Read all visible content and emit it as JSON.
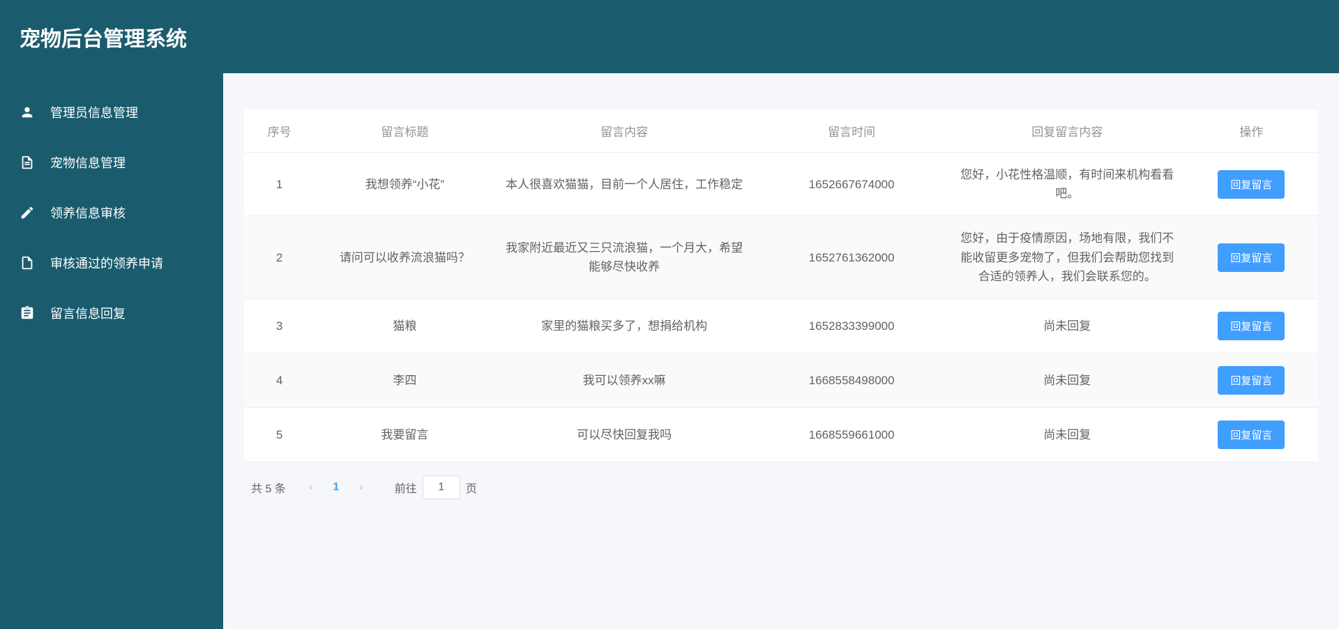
{
  "header": {
    "title": "宠物后台管理系统"
  },
  "sidebar": {
    "items": [
      {
        "label": "管理员信息管理",
        "icon": "user-icon"
      },
      {
        "label": "宠物信息管理",
        "icon": "document-icon"
      },
      {
        "label": "领养信息审核",
        "icon": "edit-icon"
      },
      {
        "label": "审核通过的领养申请",
        "icon": "file-icon"
      },
      {
        "label": "留言信息回复",
        "icon": "clipboard-icon"
      }
    ]
  },
  "table": {
    "headers": {
      "seq": "序号",
      "title": "留言标题",
      "content": "留言内容",
      "time": "留言时间",
      "reply": "回复留言内容",
      "action": "操作"
    },
    "rows": [
      {
        "seq": "1",
        "title": "我想领养“小花”",
        "content": "本人很喜欢猫猫，目前一个人居住，工作稳定",
        "time": "1652667674000",
        "reply": "您好，小花性格温顺，有时间来机构看看吧。",
        "action": "回复留言"
      },
      {
        "seq": "2",
        "title": "请问可以收养流浪猫吗？",
        "content": "我家附近最近又三只流浪猫，一个月大，希望能够尽快收养",
        "time": "1652761362000",
        "reply": "您好，由于疫情原因，场地有限，我们不能收留更多宠物了，但我们会帮助您找到合适的领养人，我们会联系您的。",
        "action": "回复留言"
      },
      {
        "seq": "3",
        "title": "猫粮",
        "content": "家里的猫粮买多了，想捐给机构",
        "time": "1652833399000",
        "reply": "尚未回复",
        "action": "回复留言"
      },
      {
        "seq": "4",
        "title": "李四",
        "content": "我可以领养xx嘛",
        "time": "1668558498000",
        "reply": "尚未回复",
        "action": "回复留言"
      },
      {
        "seq": "5",
        "title": "我要留言",
        "content": "可以尽快回复我吗",
        "time": "1668559661000",
        "reply": "尚未回复",
        "action": "回复留言"
      }
    ]
  },
  "pagination": {
    "total_text": "共 5 条",
    "current_page": "1",
    "jump_prefix": "前往",
    "jump_value": "1",
    "jump_suffix": "页"
  }
}
